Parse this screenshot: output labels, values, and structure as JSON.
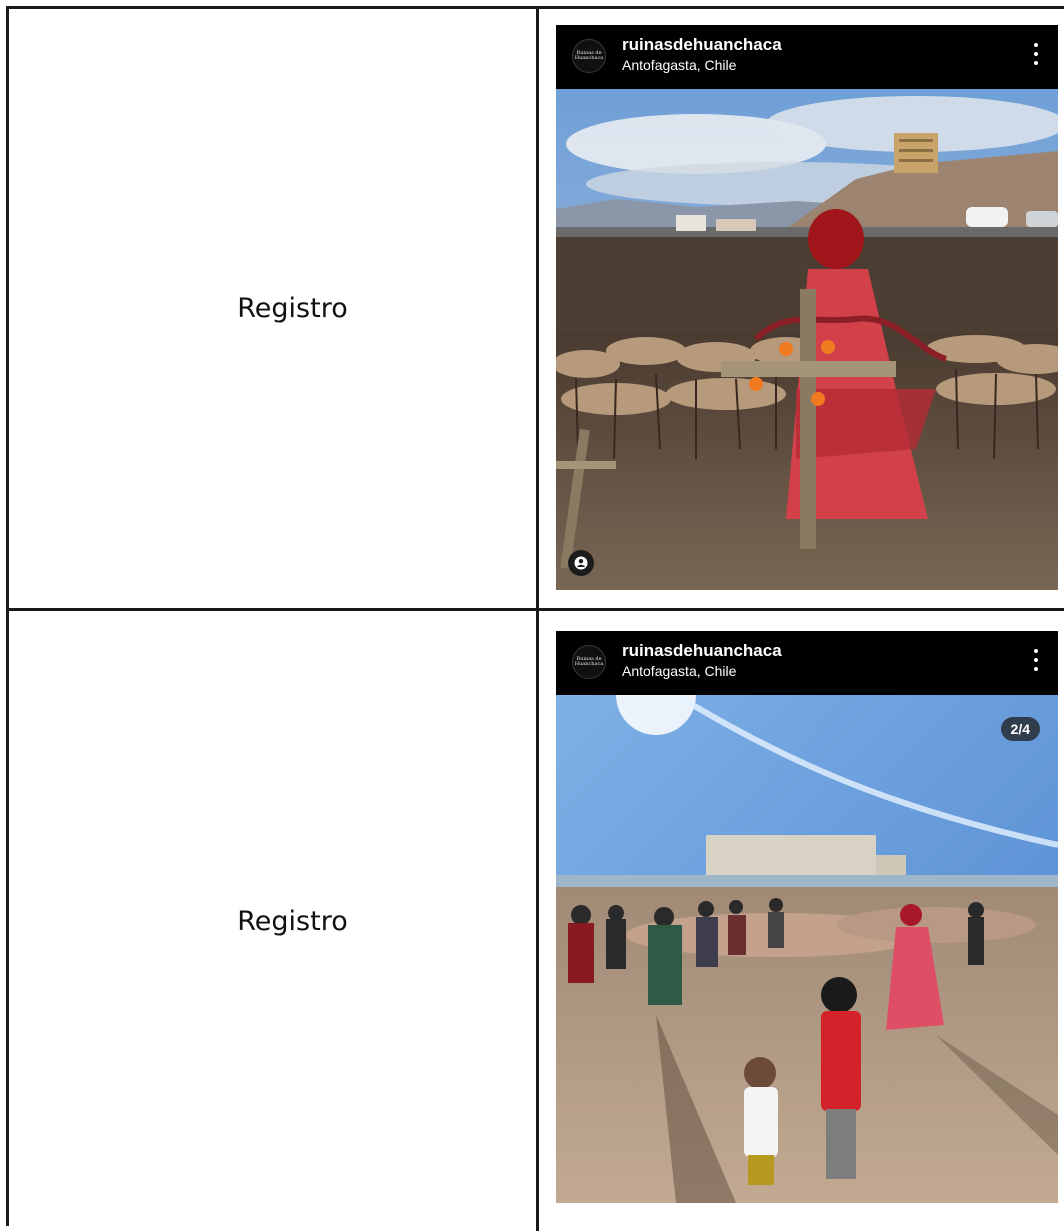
{
  "rows": [
    {
      "label": "Registro",
      "post": {
        "username": "ruinasdehuanchaca",
        "location": "Antofagasta, Chile",
        "avatar_text": [
          "Ruinas de",
          "Huanchaca"
        ],
        "photo_description_icon": "user-tag-icon"
      }
    },
    {
      "label": "Registro",
      "post": {
        "username": "ruinasdehuanchaca",
        "location": "Antofagasta, Chile",
        "avatar_text": [
          "Ruinas de",
          "Huanchaca"
        ],
        "carousel_counter": "2/4"
      }
    }
  ],
  "colors": {
    "border": "#1a1a1a",
    "post_header": "#000000",
    "header_text": "#ffffff"
  }
}
